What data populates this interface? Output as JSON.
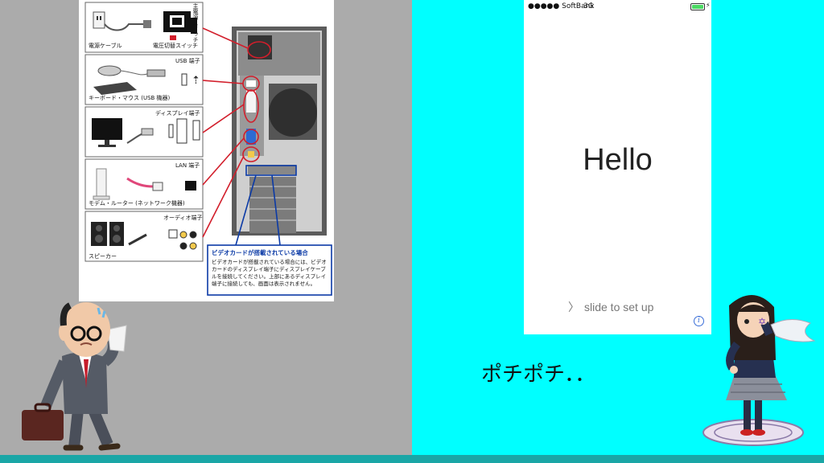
{
  "manual": {
    "labels": {
      "power_cable": "電源ケーブル",
      "voltage_switch": "電圧切替スイッチ",
      "main_power_switch": "主電源スイッチ",
      "usb_port": "USB 端子",
      "keyboard_mouse": "キーボード・マウス (USB 機器)",
      "display_port": "ディスプレイ端子",
      "lan_port": "LAN 端子",
      "modem_router": "モデム・ルーター (ネットワーク機器)",
      "audio_port": "オーディオ端子",
      "speaker": "スピーカー"
    },
    "video_card_title": "ビデオカードが搭載されている場合",
    "video_card_text": "ビデオカードが搭載されている場合には、ビデオカードのディスプレイ端子にディスプレイケーブルを接続してください。上部にあるディスプレイ端子に接続しても、画面は表示されません。"
  },
  "phone": {
    "carrier": "●●●●● SoftBank",
    "network": "3G",
    "charging_icon": "⚡",
    "hello": "Hello",
    "slide_chevron": "〉",
    "slide_text": "slide to set up",
    "info_icon": "i"
  },
  "caption": "ポチポチ．．",
  "colors": {
    "left_bg": "#ababab",
    "right_bg": "#00ffff",
    "bottom_bar": "#1aa6a6",
    "callout_red": "#d21e2b",
    "callout_blue": "#0b3aa6"
  }
}
